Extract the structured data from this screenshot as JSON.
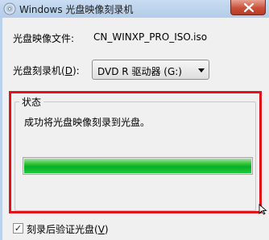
{
  "window": {
    "title": "Windows 光盘映像刻录机"
  },
  "form": {
    "image_file_label": "光盘映像文件:",
    "image_file_value": "CN_WINXP_PRO_ISO.iso",
    "burner_label_prefix": "光盘刻录机(",
    "burner_label_hotkey": "D",
    "burner_label_suffix": "):",
    "burner_selected": "DVD R 驱动器 (G:)"
  },
  "status": {
    "group_label": "状态",
    "message": "成功将光盘映像刻录到光盘。",
    "progress_fraction": 1.0,
    "progress_color": "#06b025"
  },
  "verify": {
    "checked": true,
    "label_prefix": "刻录后验证光盘(",
    "label_hotkey": "V",
    "label_suffix": ")"
  },
  "annotation": {
    "highlight_color": "#e0141a"
  }
}
